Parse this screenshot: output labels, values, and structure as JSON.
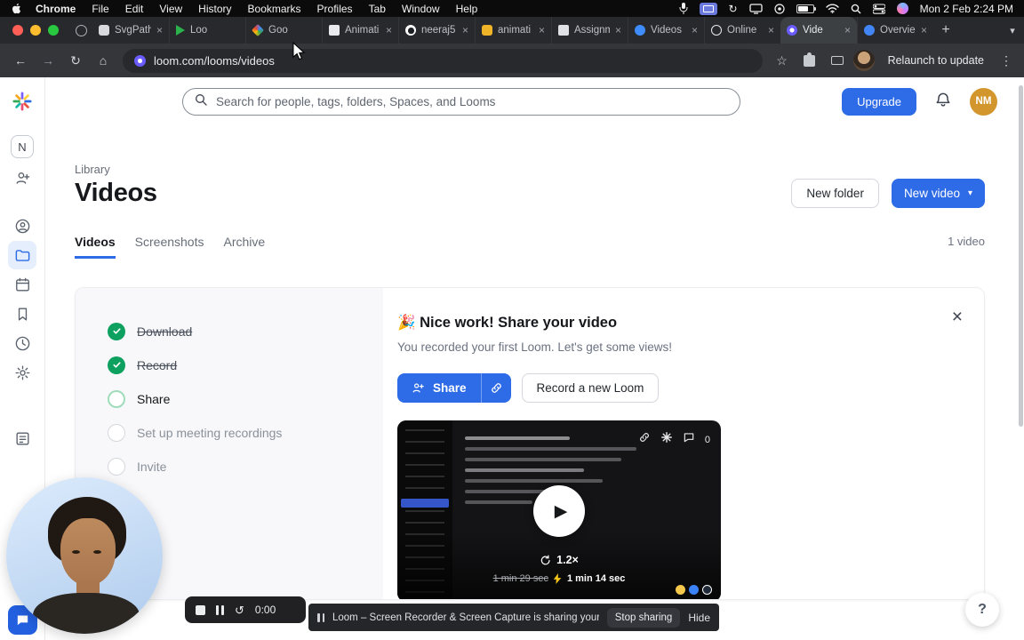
{
  "colors": {
    "accent_blue": "#2e6be6",
    "success_green": "#0da05f",
    "avatar_gold": "#d2962c"
  },
  "icons": {
    "close": "×",
    "plus": "+",
    "back": "←",
    "forward": "→",
    "reload": "↻",
    "home": "⌂",
    "star": "☆",
    "kebab": "⋮",
    "chevron_down": "▾",
    "play": "▶",
    "restart": "↺",
    "check": "✓"
  },
  "menubar": {
    "app_name": "Chrome",
    "menus": [
      "File",
      "Edit",
      "View",
      "History",
      "Bookmarks",
      "Profiles",
      "Tab",
      "Window",
      "Help"
    ],
    "clock": "Mon 2 Feb 2:24 PM"
  },
  "tabstrip": {
    "tabs": [
      {
        "label": "SvgPath"
      },
      {
        "label": "Loo"
      },
      {
        "label": "Goo"
      },
      {
        "label": "Animati"
      },
      {
        "label": "neeraj5"
      },
      {
        "label": "animati"
      },
      {
        "label": "Assignm"
      },
      {
        "label": "Videos"
      },
      {
        "label": "Online"
      },
      {
        "label": "Vide"
      },
      {
        "label": "Overvie"
      }
    ]
  },
  "toolbar": {
    "url": "loom.com/looms/videos",
    "relaunch_label": "Relaunch to update"
  },
  "loom": {
    "workspace_initial": "N",
    "search_placeholder": "Search for people, tags, folders, Spaces, and Looms",
    "upgrade_label": "Upgrade",
    "avatar_initials": "NM",
    "breadcrumb": "Library",
    "page_title": "Videos",
    "new_folder_label": "New folder",
    "new_video_label": "New video",
    "tabs": [
      {
        "label": "Videos"
      },
      {
        "label": "Screenshots"
      },
      {
        "label": "Archive"
      }
    ],
    "video_count": "1 video",
    "checklist": [
      {
        "label": "Download",
        "state": "done"
      },
      {
        "label": "Record",
        "state": "done"
      },
      {
        "label": "Share",
        "state": "current"
      },
      {
        "label": "Set up meeting recordings",
        "state": "todo"
      },
      {
        "label": "Invite",
        "state": "todo"
      }
    ],
    "share_card": {
      "title": "🎉 Nice work! Share your video",
      "subtitle": "You recorded your first Loom. Let's get some views!",
      "share_label": "Share",
      "record_label": "Record a new Loom"
    },
    "video_card": {
      "speed": "1.2×",
      "original_duration": "1 min 29 sec",
      "trimmed_duration": "1 min 14 sec",
      "comment_count": "0"
    }
  },
  "recorder_bar": {
    "time": "0:00"
  },
  "share_banner": {
    "message": "Loom – Screen Recorder & Screen Capture is sharing your screen.",
    "stop_label": "Stop sharing",
    "hide_label": "Hide"
  },
  "help_label": "?"
}
